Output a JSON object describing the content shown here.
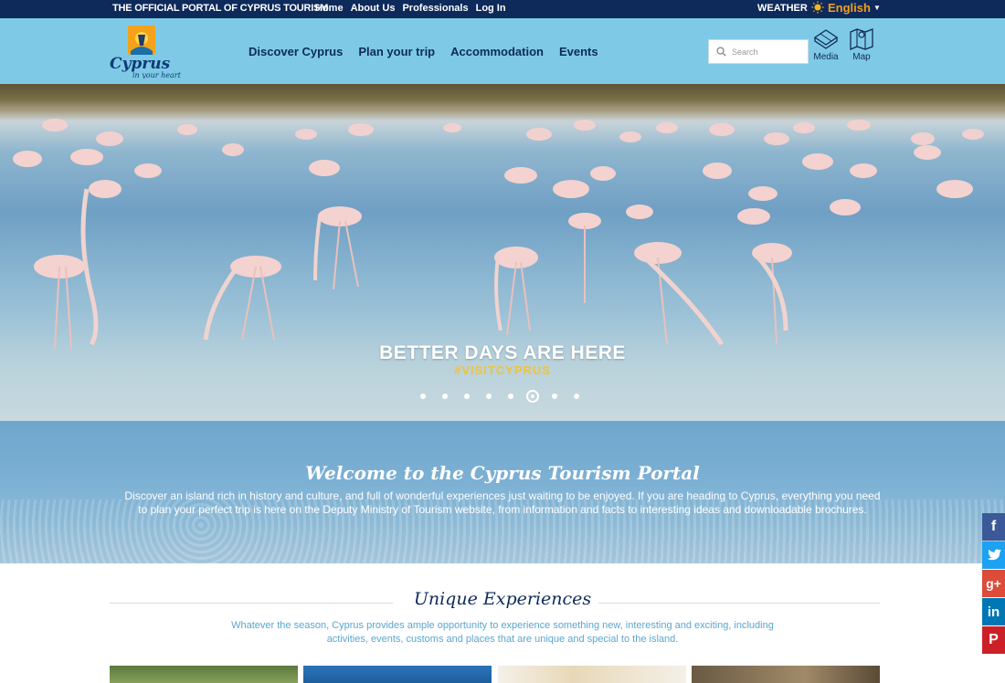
{
  "topbar": {
    "portal_label": "THE OFFICIAL PORTAL OF CYPRUS TOURISM",
    "links": [
      "Home",
      "About Us",
      "Professionals",
      "Log In"
    ],
    "weather_label": "WEATHER",
    "language": "English"
  },
  "header": {
    "logo_text": "Cyprus",
    "logo_tagline": "in your heart",
    "nav": [
      "Discover Cyprus",
      "Plan your trip",
      "Accommodation",
      "Events"
    ],
    "search_placeholder": "Search",
    "media_label": "Media",
    "map_label": "Map"
  },
  "hero": {
    "title": "BETTER DAYS ARE HERE",
    "tagline": "#VISITCYPRUS",
    "slide_count": 8,
    "active_slide": 6
  },
  "welcome": {
    "title": "Welcome to the Cyprus Tourism Portal",
    "text": "Discover an island rich in history and culture, and full of wonderful experiences just waiting to be enjoyed. If you are heading to Cyprus, everything you need to plan your perfect trip is here on the Deputy Ministry of Tourism website, from information and facts to interesting ideas and downloadable brochures."
  },
  "unique": {
    "title": "Unique Experiences",
    "text": "Whatever the season, Cyprus provides ample opportunity to experience something new, interesting and exciting, including activities, events, customs and places that are unique and special to the island."
  },
  "social": {
    "icons": [
      "facebook-icon",
      "twitter-icon",
      "google-plus-icon",
      "linkedin-icon",
      "pinterest-icon"
    ],
    "colors": [
      "#3b5998",
      "#1da1f2",
      "#dd4b39",
      "#0077b5",
      "#cb2027"
    ]
  },
  "colors": {
    "topbar": "#0e2a5a",
    "header": "#7ecae6",
    "accent": "#f0a020",
    "hero_tagline": "#f2c23a"
  }
}
